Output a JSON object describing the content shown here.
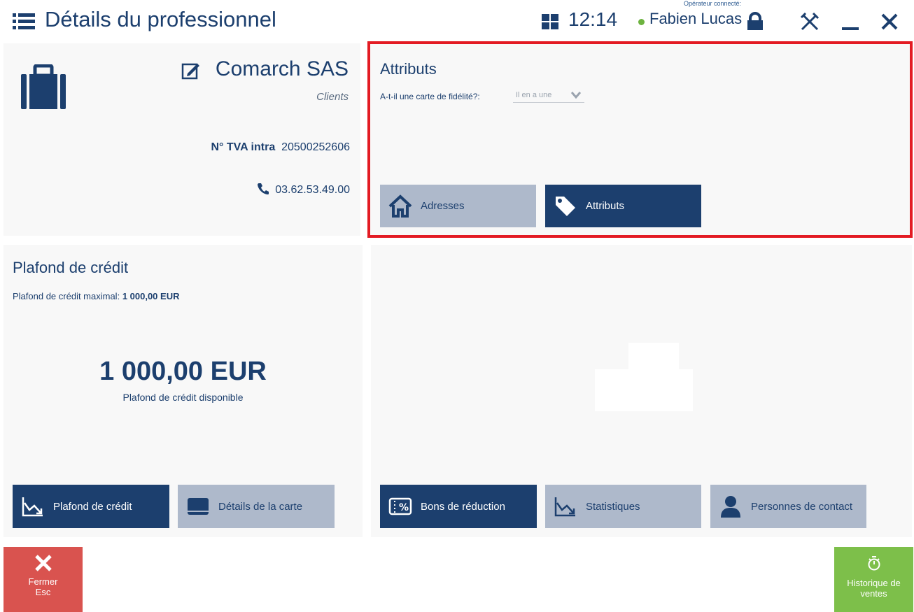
{
  "header": {
    "title": "Détails du professionnel",
    "time": "12:14",
    "operator_label": "Opérateur connecté:",
    "operator_name": "Fabien Lucas"
  },
  "customer": {
    "name": "Comarch SAS",
    "type": "Clients",
    "tva_label": "N° TVA intra",
    "tva_value": "20500252606",
    "phone": "03.62.53.49.00"
  },
  "attributes": {
    "title": "Attributs",
    "question": "A-t-il une carte de fidélité?:",
    "answer": "Il en a une"
  },
  "tabs_top": {
    "adresses": "Adresses",
    "attributs": "Attributs"
  },
  "credit": {
    "title": "Plafond de crédit",
    "max_label": "Plafond de crédit maximal:",
    "max_value": "1 000,00 EUR",
    "available_amount": "1 000,00 EUR",
    "available_label": "Plafond de crédit disponible"
  },
  "tabs_bottom_left": {
    "plafond": "Plafond de crédit",
    "carte": "Détails de la carte"
  },
  "tabs_bottom_right": {
    "bons": "Bons de réduction",
    "stats": "Statistiques",
    "contacts": "Personnes de contact"
  },
  "footer": {
    "close_label": "Fermer",
    "close_key": "Esc",
    "history_line1": "Historique de",
    "history_line2": "ventes"
  },
  "colors": {
    "primary": "#1c3f6e",
    "inactive_tab": "#aeb9cb",
    "highlight": "#e31b23",
    "close": "#d9534f",
    "history": "#7dbf4a",
    "online": "#6db33f"
  }
}
